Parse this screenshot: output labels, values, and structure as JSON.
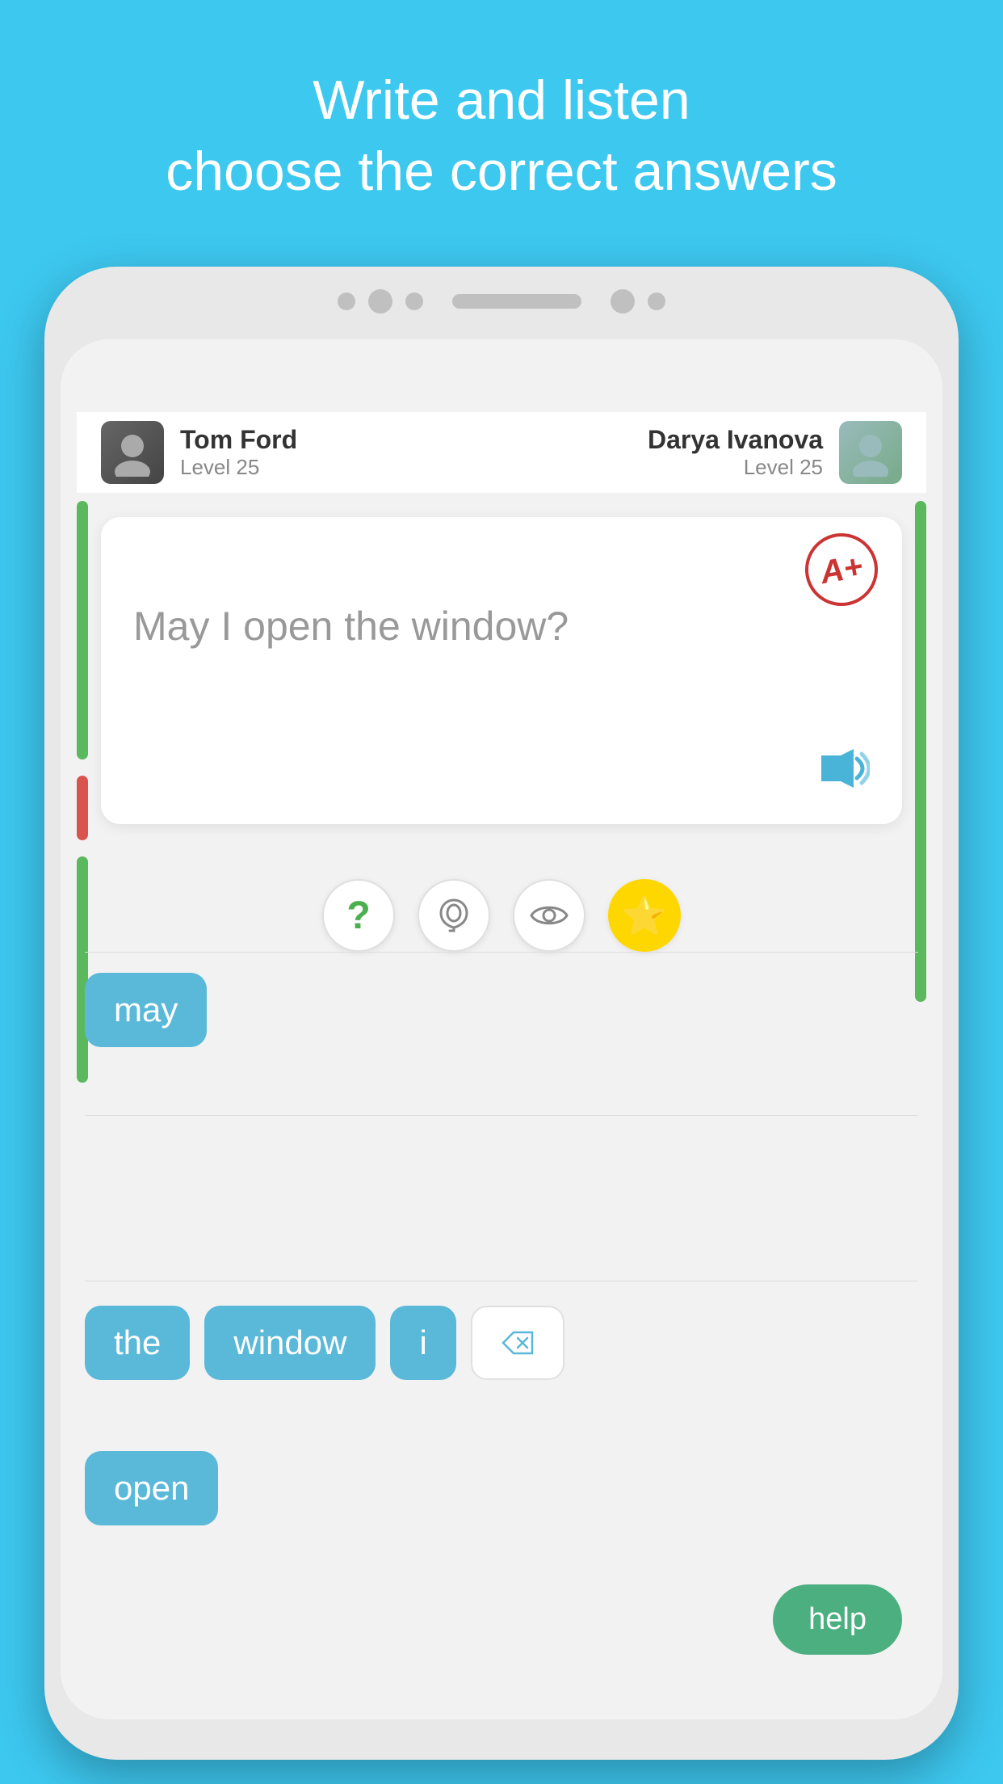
{
  "header": {
    "line1": "Write and listen",
    "line2": "choose the correct answers"
  },
  "players": {
    "left": {
      "name": "Tom Ford",
      "level": "Level 25",
      "avatar_emoji": "👤"
    },
    "right": {
      "name": "Darya Ivanova",
      "level": "Level 25",
      "avatar_emoji": "👤"
    }
  },
  "question": {
    "text": "May I open the window?",
    "grade": "A+",
    "audio_icon": "🔊"
  },
  "hints": [
    {
      "id": "question-hint",
      "icon": "?",
      "color": "#4caf50"
    },
    {
      "id": "listen-hint",
      "icon": "👂",
      "color": "#888"
    },
    {
      "id": "eye-hint",
      "icon": "👁",
      "color": "#888"
    },
    {
      "id": "star-hint",
      "icon": "⭐",
      "color": "#ffd700"
    }
  ],
  "current_answer": {
    "words": [
      "may"
    ]
  },
  "word_choices": {
    "row1": [
      {
        "label": "the",
        "style": "blue"
      },
      {
        "label": "window",
        "style": "blue"
      },
      {
        "label": "i",
        "style": "blue"
      },
      {
        "label": "⌫",
        "style": "white"
      }
    ],
    "row2": [
      {
        "label": "open",
        "style": "blue"
      }
    ]
  },
  "help_button": {
    "label": "help"
  }
}
